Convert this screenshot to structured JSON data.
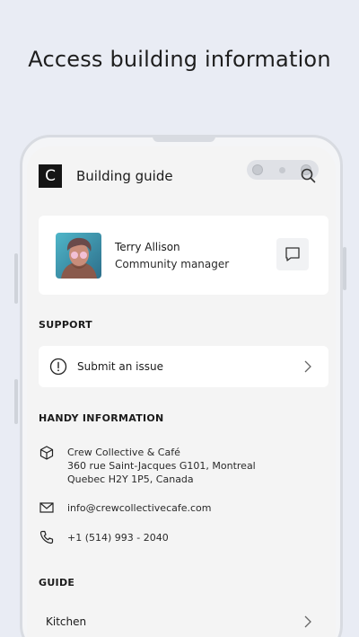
{
  "headline": "Access building information",
  "app": {
    "logo_letter": "C",
    "title": "Building guide"
  },
  "contact": {
    "name": "Terry Allison",
    "role": "Community manager"
  },
  "support": {
    "section_label": "SUPPORT",
    "submit_issue_label": "Submit an issue"
  },
  "handy_info": {
    "section_label": "HANDY INFORMATION",
    "address_lines": [
      "Crew Collective & Café",
      "360 rue Saint-Jacques G101, Montreal",
      "Quebec H2Y 1P5, Canada"
    ],
    "email": "info@crewcollectivecafe.com",
    "phone": "+1 (514) 993 - 2040"
  },
  "guide": {
    "section_label": "GUIDE",
    "items": [
      "Kitchen"
    ]
  },
  "icons": {
    "search": "search-icon",
    "chat": "chat-bubble-icon",
    "issue": "exclamation-circle-icon",
    "address": "cube-icon",
    "email": "envelope-icon",
    "phone": "phone-icon",
    "chevron": "chevron-right-icon"
  },
  "colors": {
    "background": "#e9ecf4",
    "screen": "#f4f4f4",
    "card": "#ffffff",
    "logo": "#151515"
  }
}
